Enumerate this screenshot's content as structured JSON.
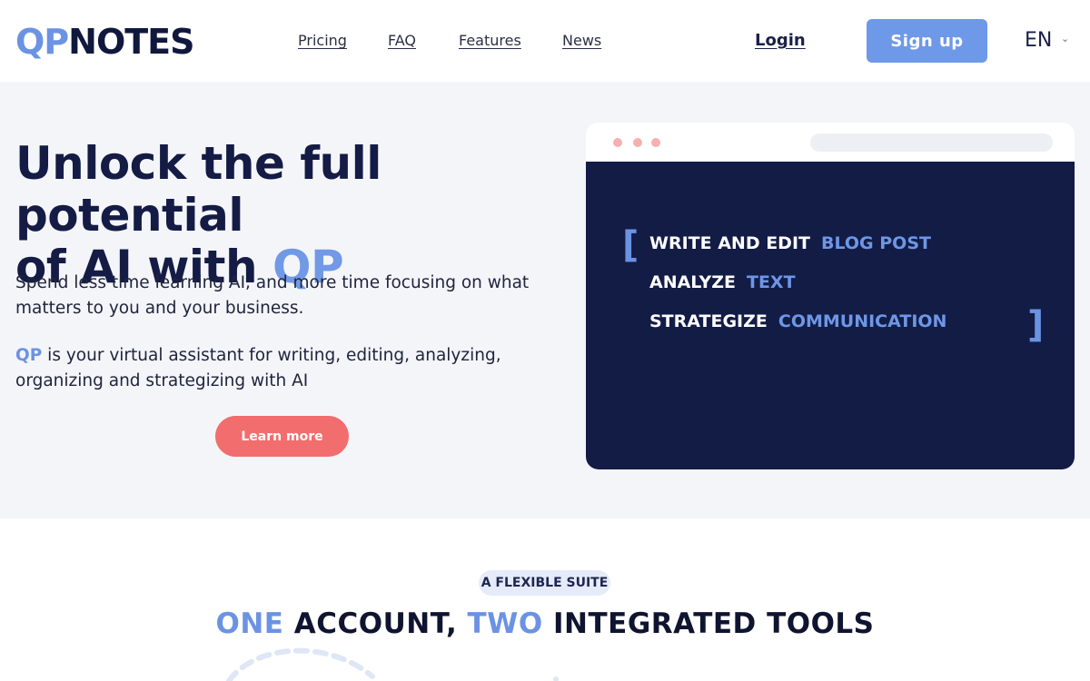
{
  "header": {
    "logo": {
      "part1": "QP",
      "part2": "NOTES"
    },
    "nav": [
      "Pricing",
      "FAQ",
      "Features",
      "News"
    ],
    "login": "Login",
    "signup": "Sign up",
    "language": "EN"
  },
  "hero": {
    "title_line1": "Unlock the full potential",
    "title_line2_prefix": "of AI with ",
    "title_line2_highlight": "QP",
    "paragraph1": "Spend less time learning AI, and more time focusing on what matters to you and your business.",
    "paragraph2_highlight": "QP",
    "paragraph2_rest": " is your virtual assistant for writing, editing, analyzing, organizing and strategizing with AI",
    "cta": "Learn more"
  },
  "mockup": {
    "bracket_open": "[",
    "bracket_close": "]",
    "rows": [
      {
        "action": "WRITE AND EDIT",
        "object": "BLOG POST"
      },
      {
        "action": "ANALYZE",
        "object": "TEXT"
      },
      {
        "action": "STRATEGIZE",
        "object": "COMMUNICATION"
      }
    ]
  },
  "suite": {
    "badge": "A FLEXIBLE SUITE",
    "title_hl1": "ONE",
    "title_mid": " ACCOUNT, ",
    "title_hl2": "TWO",
    "title_end": " INTEGRATED TOOLS"
  },
  "colors": {
    "accent": "#6b93e3",
    "navy": "#131c45",
    "cta": "#f26d6d",
    "hero_bg": "#f4f5f9"
  }
}
